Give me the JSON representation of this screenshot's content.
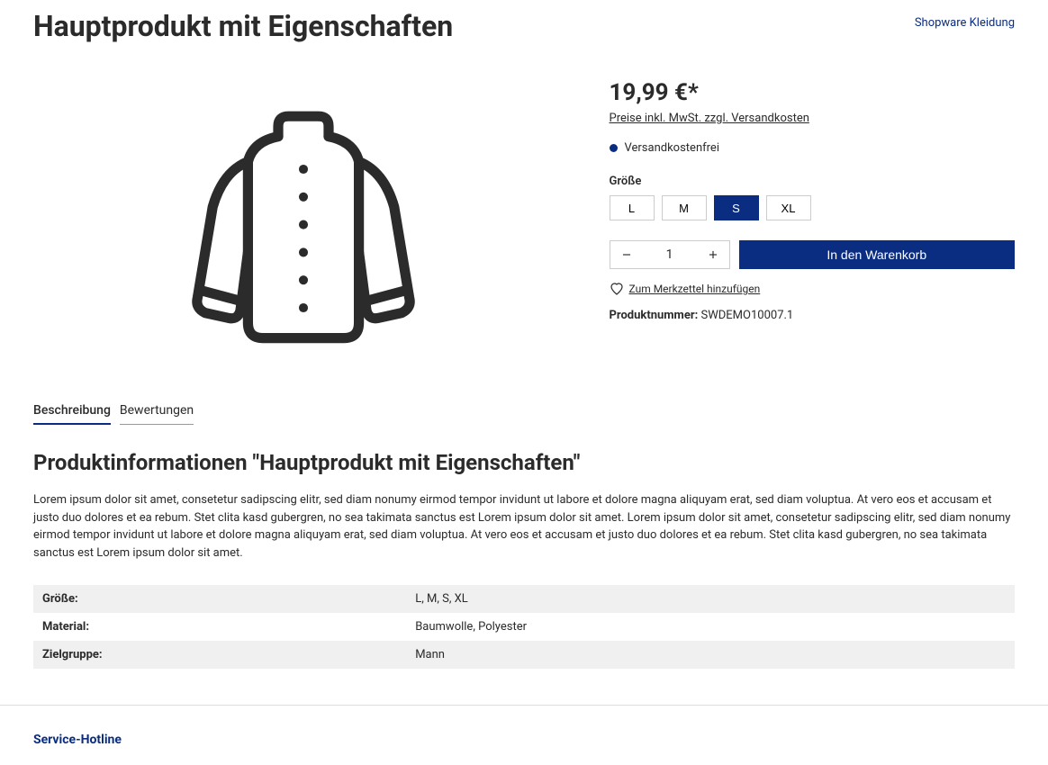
{
  "header": {
    "title": "Hauptprodukt mit Eigenschaften",
    "brand_link": "Shopware Kleidung"
  },
  "product": {
    "price": "19,99 €*",
    "price_note": "Preise inkl. MwSt. zzgl. Versandkosten",
    "shipping_label": "Versandkostenfrei",
    "size_label": "Größe",
    "sizes": [
      "L",
      "M",
      "S",
      "XL"
    ],
    "size_selected": "S",
    "quantity": "1",
    "add_to_cart": "In den Warenkorb",
    "wishlist": "Zum Merkzettel hinzufügen",
    "product_number_label": "Produktnummer:",
    "product_number": "SWDEMO10007.1"
  },
  "tabs": {
    "description": "Beschreibung",
    "reviews": "Bewertungen"
  },
  "info": {
    "title": "Produktinformationen \"Hauptprodukt mit Eigenschaften\"",
    "description": "Lorem ipsum dolor sit amet, consetetur sadipscing elitr, sed diam nonumy eirmod tempor invidunt ut labore et dolore magna aliquyam erat, sed diam voluptua. At vero eos et accusam et justo duo dolores et ea rebum. Stet clita kasd gubergren, no sea takimata sanctus est Lorem ipsum dolor sit amet. Lorem ipsum dolor sit amet, consetetur sadipscing elitr, sed diam nonumy eirmod tempor invidunt ut labore et dolore magna aliquyam erat, sed diam voluptua. At vero eos et accusam et justo duo dolores et ea rebum. Stet clita kasd gubergren, no sea takimata sanctus est Lorem ipsum dolor sit amet.",
    "props": [
      {
        "label": "Größe:",
        "value": "L, M, S, XL"
      },
      {
        "label": "Material:",
        "value": "Baumwolle, Polyester"
      },
      {
        "label": "Zielgruppe:",
        "value": "Mann"
      }
    ]
  },
  "footer": {
    "hotline_title": "Service-Hotline"
  }
}
